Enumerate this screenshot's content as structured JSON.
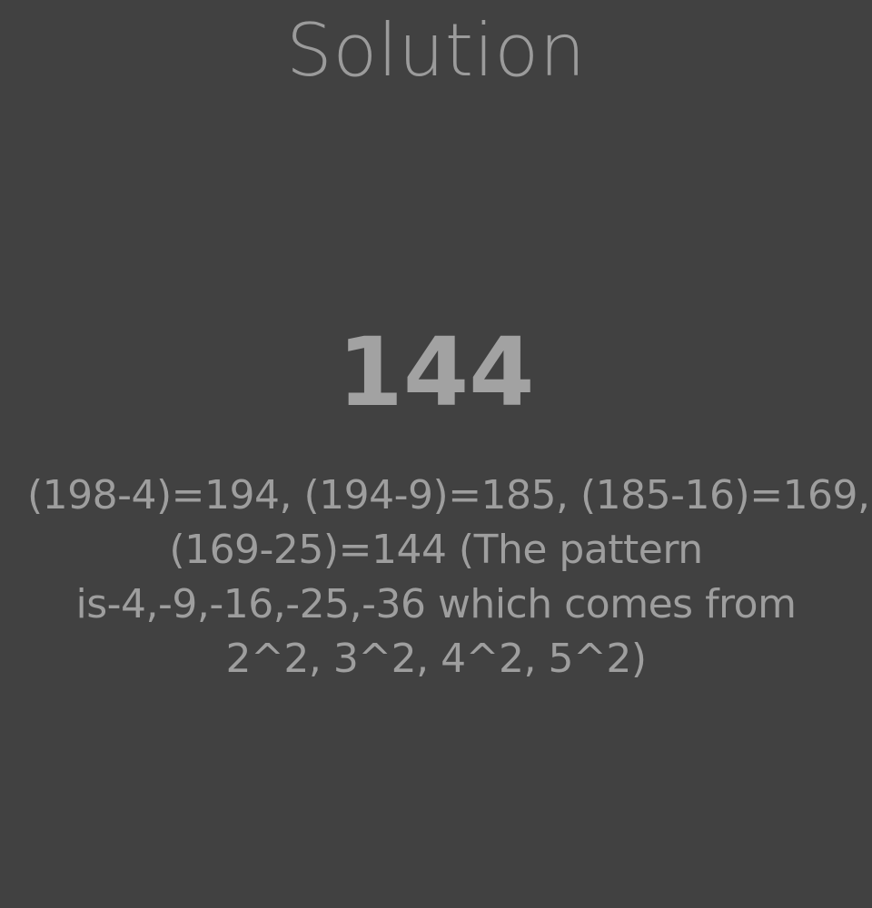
{
  "title": "Solution",
  "answer": "144",
  "explanation": {
    "lines": [
      "(198-4)=194, (194-9)=185, (185-16)=169,",
      "(169-25)=144 (The pattern",
      "is-4,-9,-16,-25,-36 which comes from",
      "2^2, 3^2, 4^2, 5^2)"
    ]
  },
  "colors": {
    "background": "#414141",
    "text": "#9e9e9e"
  }
}
